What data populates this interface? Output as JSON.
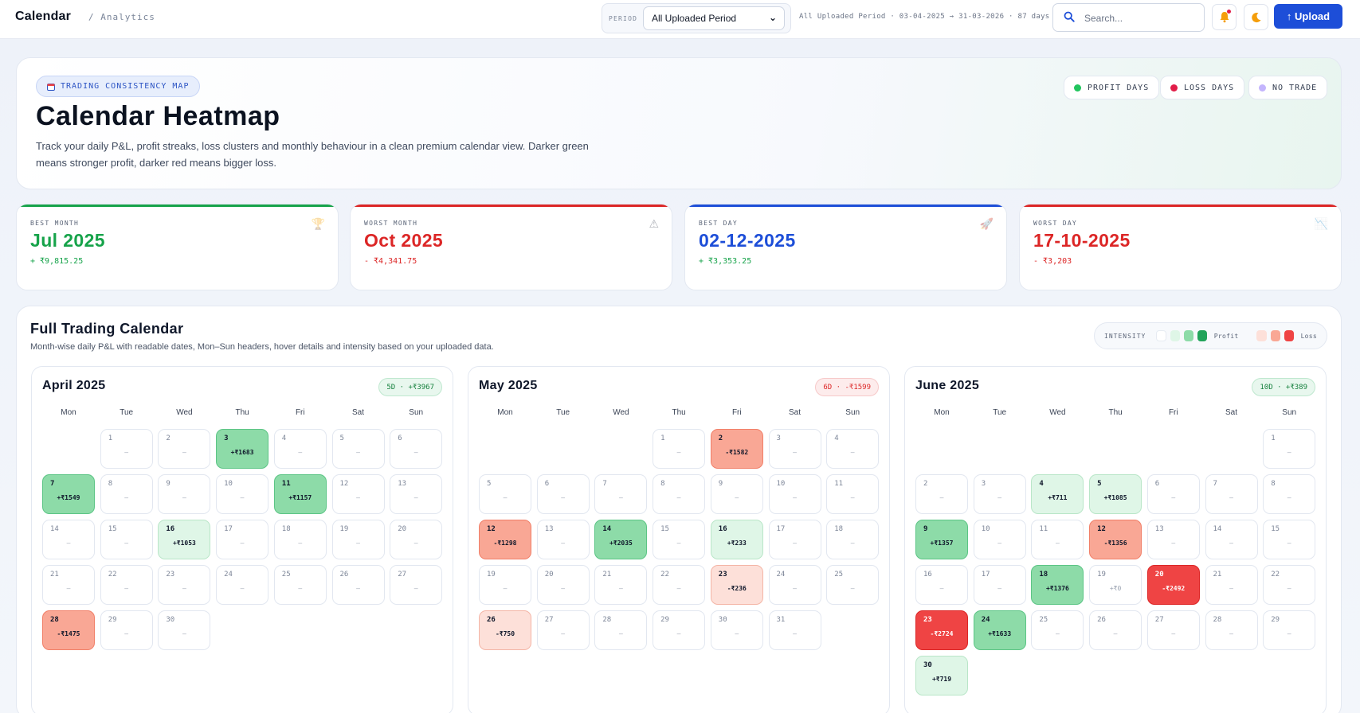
{
  "header": {
    "brand": "Calendar",
    "crumb": "/ Analytics",
    "period_label": "PERIOD",
    "period_value": "All Uploaded Period",
    "range_info": "All Uploaded Period · 03-04-2025 → 31-03-2026 · 87 days",
    "search_placeholder": "Search...",
    "upload_label": "↑ Upload"
  },
  "hero": {
    "tag": "TRADING CONSISTENCY MAP",
    "title": "Calendar Heatmap",
    "description": "Track your daily P&L, profit streaks, loss clusters and monthly behaviour in a clean premium calendar view. Darker green means stronger profit, darker red means bigger loss.",
    "legend": [
      {
        "label": "PROFIT DAYS",
        "color": "#22c55e"
      },
      {
        "label": "LOSS DAYS",
        "color": "#e11d48"
      },
      {
        "label": "NO TRADE",
        "color": "#c4b5fd"
      }
    ]
  },
  "stats": [
    {
      "label": "BEST MONTH",
      "value": "Jul 2025",
      "sub": "+ ₹9,815.25",
      "color": "#16a34a",
      "icon": "trophy-icon"
    },
    {
      "label": "WORST MONTH",
      "value": "Oct 2025",
      "sub": "- ₹4,341.75",
      "color": "#dc2626",
      "icon": "warning-icon"
    },
    {
      "label": "BEST DAY",
      "value": "02-12-2025",
      "sub": "+ ₹3,353.25",
      "color": "#1d4ed8",
      "icon": "rocket-icon"
    },
    {
      "label": "WORST DAY",
      "value": "17-10-2025",
      "sub": "- ₹3,203",
      "color": "#dc2626",
      "icon": "chart-down-icon"
    }
  ],
  "calendar": {
    "title": "Full Trading Calendar",
    "subtitle": "Month-wise daily P&L with readable dates, Mon–Sun headers, hover details and intensity based on your uploaded data.",
    "intensity_label": "INTENSITY",
    "profit_label": "Profit",
    "loss_label": "Loss",
    "weekdays": [
      "Mon",
      "Tue",
      "Wed",
      "Thu",
      "Fri",
      "Sat",
      "Sun"
    ],
    "months": [
      {
        "title": "April 2025",
        "badge": "5D · +₹3967",
        "badge_type": "pos",
        "offset": 1,
        "days": 30,
        "entries": {
          "3": [
            "+₹1683",
            "g3"
          ],
          "7": [
            "+₹1549",
            "g3"
          ],
          "11": [
            "+₹1157",
            "g3"
          ],
          "16": [
            "+₹1053",
            "g1"
          ],
          "28": [
            "-₹1475",
            "r2"
          ]
        }
      },
      {
        "title": "May 2025",
        "badge": "6D · -₹1599",
        "badge_type": "neg",
        "offset": 3,
        "days": 31,
        "entries": {
          "2": [
            "-₹1582",
            "r2"
          ],
          "12": [
            "-₹1298",
            "r2"
          ],
          "14": [
            "+₹2035",
            "g3"
          ],
          "16": [
            "+₹233",
            "g1"
          ],
          "23": [
            "-₹236",
            "r1"
          ],
          "26": [
            "-₹750",
            "r1"
          ]
        }
      },
      {
        "title": "June 2025",
        "badge": "10D · +₹389",
        "badge_type": "pos",
        "offset": 6,
        "days": 30,
        "entries": {
          "4": [
            "+₹711",
            "g1"
          ],
          "5": [
            "+₹1085",
            "g1"
          ],
          "9": [
            "+₹1357",
            "g3"
          ],
          "12": [
            "-₹1356",
            "r2"
          ],
          "18": [
            "+₹1376",
            "g3"
          ],
          "19": [
            "+₹0",
            "none"
          ],
          "20": [
            "-₹2492",
            "r3"
          ],
          "23": [
            "-₹2724",
            "r3"
          ],
          "24": [
            "+₹1633",
            "g3"
          ],
          "30": [
            "+₹719",
            "g1"
          ]
        }
      }
    ],
    "empty_value": "–"
  }
}
